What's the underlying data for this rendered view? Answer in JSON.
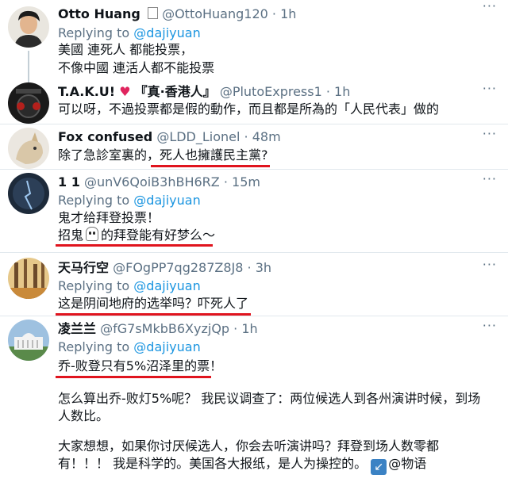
{
  "tweets": [
    {
      "name": "Otto Huang",
      "handle": "@OttoHuang120",
      "time": "1h",
      "replying_prefix": "Replying to",
      "replying_to": "@dajiyuan",
      "lines": [
        "美國 連死人 都能投票，",
        "不像中國 連活人都不能投票"
      ]
    },
    {
      "name_a": "T.A.K.U!",
      "heart": "♥",
      "name_b": "『真·香港人』",
      "handle": "@PlutoExpress1",
      "time": "1h",
      "lines": [
        "可以呀，不過投票都是假的動作，而且都是所為的「人民代表」做的"
      ]
    },
    {
      "name": "Fox confused",
      "handle": "@LDD_Lionel",
      "time": "48m",
      "lines": [
        "除了急診室裏的，死人也擁護民主黨?"
      ]
    },
    {
      "name": "1 1",
      "handle": "@unV6QoiB3hBH6RZ",
      "time": "15m",
      "replying_prefix": "Replying to",
      "replying_to": "@dajiyuan",
      "line1": "鬼才给拜登投票！",
      "line2_a": "招鬼",
      "line2_b": "的拜登能有好梦么～"
    },
    {
      "name": "天马行空",
      "handle": "@FOgPP7qg287Z8J8",
      "time": "3h",
      "replying_prefix": "Replying to",
      "replying_to": "@dajiyuan",
      "lines": [
        "这是阴间地府的选举吗？吓死人了"
      ]
    },
    {
      "name": "凌兰兰",
      "handle": "@fG7sMkbB6XyzjQp",
      "time": "1h",
      "replying_prefix": "Replying to",
      "replying_to": "@dajiyuan",
      "lines": [
        "乔-败登只有5%沼泽里的票！"
      ],
      "para1": [
        "怎么算出乔-败灯5%呢？ 我民议调查了：两位候选人到各州演讲时候，到场",
        "人数比。"
      ],
      "para2": [
        "大家想想，如果你讨厌候选人，你会去听演讲吗？拜登到场人数零都",
        "有！！！ 我是科学的。美国各大报纸，是人为操控的。"
      ],
      "para2_end": "@物语",
      "badge_icon": "arrow-down-left-icon"
    }
  ],
  "separator": "·",
  "more_label": "···"
}
